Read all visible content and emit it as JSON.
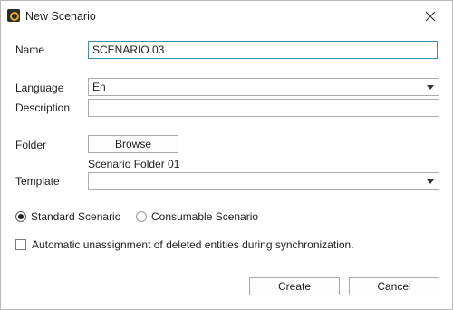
{
  "window": {
    "title": "New Scenario"
  },
  "form": {
    "name_label": "Name",
    "name_value": "SCENARIO 03",
    "language_label": "Language",
    "language_value": "En",
    "description_label": "Description",
    "description_value": "",
    "folder_label": "Folder",
    "browse_label": "Browse",
    "folder_value": "Scenario Folder 01",
    "template_label": "Template",
    "template_value": ""
  },
  "scenario_type": {
    "options": [
      "Standard Scenario",
      "Consumable Scenario"
    ],
    "selected": "Standard Scenario"
  },
  "checkbox": {
    "label": "Automatic unassignment of deleted entities during synchronization.",
    "checked": false
  },
  "buttons": {
    "create": "Create",
    "cancel": "Cancel"
  },
  "icons": {
    "app": "app-logo-icon",
    "close": "close-icon",
    "dropdown": "chevron-down-icon"
  }
}
